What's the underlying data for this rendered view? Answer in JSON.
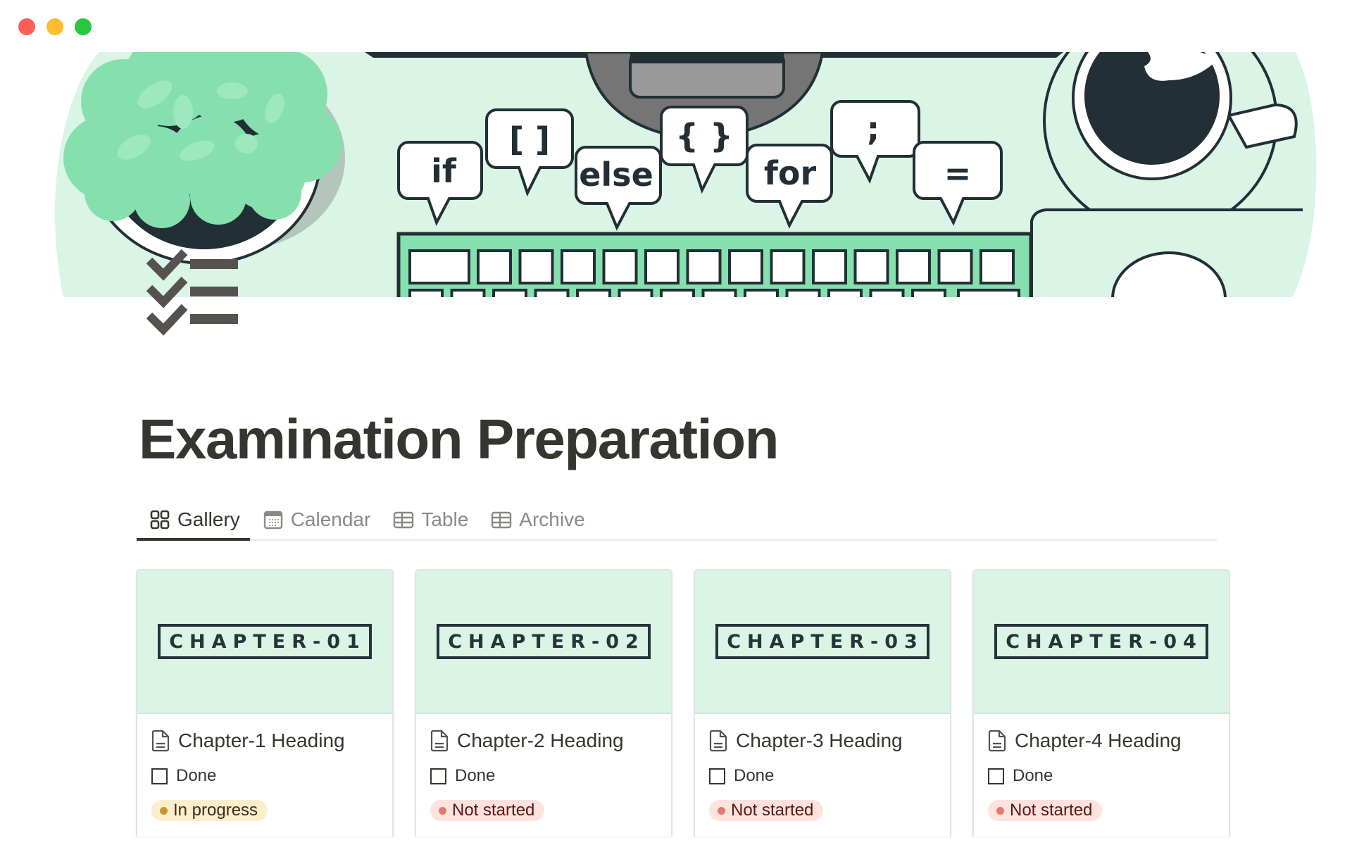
{
  "window": {
    "controls": [
      {
        "name": "close",
        "color": "#ff5f57"
      },
      {
        "name": "minimize",
        "color": "#febc2e"
      },
      {
        "name": "zoom",
        "color": "#28c840"
      }
    ]
  },
  "banner": {
    "description": "Illustration of a desk with keyboard, plant, coffee cup and code speech bubbles",
    "bubbles": [
      "if",
      "[ ]",
      "else",
      "{ }",
      "for",
      ";",
      "="
    ],
    "colors": {
      "background": "#daf4e6",
      "accent": "#85e0ae",
      "ink": "#222f36"
    }
  },
  "page": {
    "icon": "checklist-icon",
    "title": "Examination Preparation"
  },
  "tabs": [
    {
      "label": "Gallery",
      "icon": "gallery-icon",
      "active": true
    },
    {
      "label": "Calendar",
      "icon": "calendar-icon",
      "active": false
    },
    {
      "label": "Table",
      "icon": "table-icon",
      "active": false
    },
    {
      "label": "Archive",
      "icon": "table-icon",
      "active": false
    }
  ],
  "cards": [
    {
      "cover_label": "CHAPTER-01",
      "title": "Chapter-1 Heading",
      "checkbox_label": "Done",
      "checked": false,
      "status": {
        "label": "In progress",
        "bg": "#fbeecb",
        "dot": "#cb9433",
        "text": "#402c1b"
      }
    },
    {
      "cover_label": "CHAPTER-02",
      "title": "Chapter-2 Heading",
      "checkbox_label": "Done",
      "checked": false,
      "status": {
        "label": "Not started",
        "bg": "#fde2dd",
        "dot": "#df7c6d",
        "text": "#5d1715"
      }
    },
    {
      "cover_label": "CHAPTER-03",
      "title": "Chapter-3 Heading",
      "checkbox_label": "Done",
      "checked": false,
      "status": {
        "label": "Not started",
        "bg": "#fde2dd",
        "dot": "#df7c6d",
        "text": "#5d1715"
      }
    },
    {
      "cover_label": "CHAPTER-04",
      "title": "Chapter-4 Heading",
      "checkbox_label": "Done",
      "checked": false,
      "status": {
        "label": "Not started",
        "bg": "#fde2dd",
        "dot": "#df7c6d",
        "text": "#5d1715"
      }
    }
  ]
}
